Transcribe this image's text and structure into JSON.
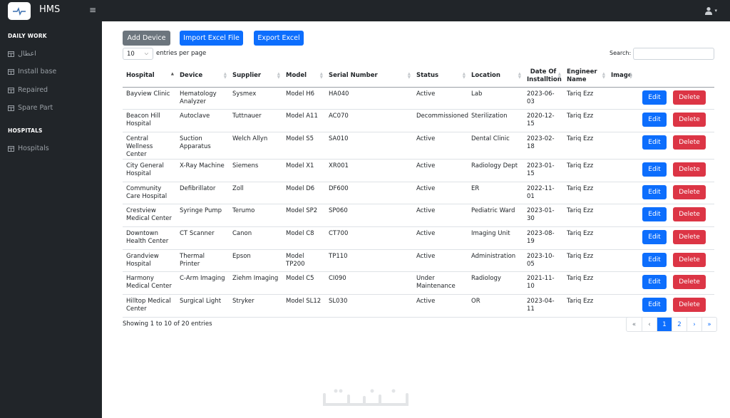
{
  "app": {
    "title": "HMS"
  },
  "topbar": {
    "menu_glyph": "≡",
    "user_icon": "user-icon",
    "user_caret": "▾"
  },
  "sidebar": {
    "sections": [
      {
        "heading": "DAILY WORK",
        "items": [
          {
            "label": "اعطال",
            "icon": "table-icon"
          },
          {
            "label": "Install base",
            "icon": "table-icon"
          },
          {
            "label": "Repaired",
            "icon": "table-icon"
          },
          {
            "label": "Spare Part",
            "icon": "table-icon"
          }
        ]
      },
      {
        "heading": "HOSPITALS",
        "items": [
          {
            "label": "Hospitals",
            "icon": "table-icon"
          }
        ]
      }
    ]
  },
  "toolbar": {
    "add_device": "Add Device",
    "import_excel": "Import Excel File",
    "export_excel": "Export Excel"
  },
  "table_controls": {
    "page_length": "10",
    "page_length_chevron": "⌵",
    "entries_label": "entries per page",
    "search_label": "Search:"
  },
  "table": {
    "columns": [
      "Hospital",
      "Device",
      "Supplier",
      "Model",
      "Serial Number",
      "Status",
      "Location",
      "Date Of Installtion",
      "Engineer Name",
      "Image",
      ""
    ],
    "edit_label": "Edit",
    "delete_label": "Delete",
    "rows": [
      [
        "Bayview Clinic",
        "Hematology Analyzer",
        "Sysmex",
        "Model H6",
        "HA040",
        "Active",
        "Lab",
        "2023-06-03",
        "Tariq Ezz"
      ],
      [
        "Beacon Hill Hospital",
        "Autoclave",
        "Tuttnauer",
        "Model A11",
        "AC070",
        "Decommissioned",
        "Sterilization",
        "2020-12-15",
        "Tariq Ezz"
      ],
      [
        "Central Wellness Center",
        "Suction Apparatus",
        "Welch Allyn",
        "Model S5",
        "SA010",
        "Active",
        "Dental Clinic",
        "2023-02-18",
        "Tariq Ezz"
      ],
      [
        "City General Hospital",
        "X-Ray Machine",
        "Siemens",
        "Model X1",
        "XR001",
        "Active",
        "Radiology Dept",
        "2023-01-15",
        "Tariq Ezz"
      ],
      [
        "Community Care Hospital",
        "Defibrillator",
        "Zoll",
        "Model D6",
        "DF600",
        "Active",
        "ER",
        "2022-11-01",
        "Tariq Ezz"
      ],
      [
        "Crestview Medical Center",
        "Syringe Pump",
        "Terumo",
        "Model SP2",
        "SP060",
        "Active",
        "Pediatric Ward",
        "2023-01-30",
        "Tariq Ezz"
      ],
      [
        "Downtown Health Center",
        "CT Scanner",
        "Canon",
        "Model C8",
        "CT700",
        "Active",
        "Imaging Unit",
        "2023-08-19",
        "Tariq Ezz"
      ],
      [
        "Grandview Hospital",
        "Thermal Printer",
        "Epson",
        "Model TP200",
        "TP110",
        "Active",
        "Administration",
        "2023-10-05",
        "Tariq Ezz"
      ],
      [
        "Harmony Medical Center",
        "C-Arm Imaging",
        "Ziehm Imaging",
        "Model C5",
        "CI090",
        "Under Maintenance",
        "Radiology",
        "2021-11-10",
        "Tariq Ezz"
      ],
      [
        "Hilltop Medical Center",
        "Surgical Light",
        "Stryker",
        "Model SL12",
        "SL030",
        "Active",
        "OR",
        "2023-04-11",
        "Tariq Ezz"
      ]
    ]
  },
  "footer": {
    "info": "Showing 1 to 10 of 20 entries",
    "pagination": [
      "«",
      "‹",
      "1",
      "2",
      "›",
      "»"
    ],
    "active_page": "1"
  },
  "colors": {
    "sidebar_bg": "#212529",
    "primary": "#0d6efd",
    "secondary": "#6c757d",
    "danger": "#dc3545"
  }
}
